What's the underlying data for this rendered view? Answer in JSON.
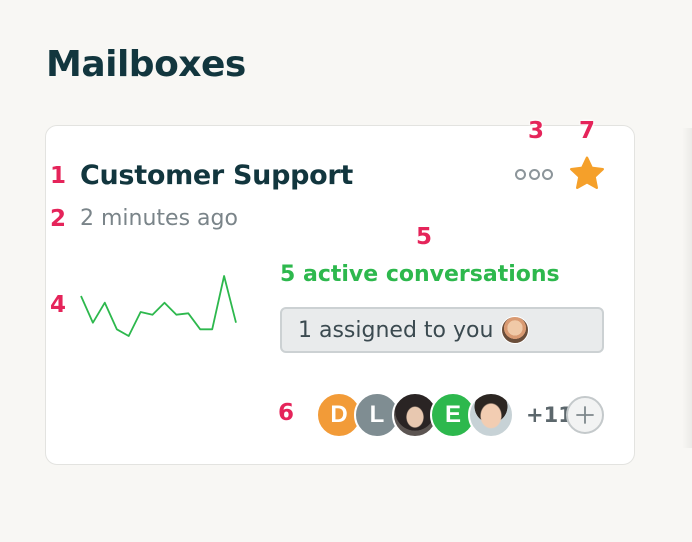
{
  "page": {
    "title": "Mailboxes"
  },
  "mailbox": {
    "name": "Customer Support",
    "updated": "2 minutes ago",
    "active_conversations": "5 active conversations",
    "assigned": "1 assigned to you",
    "starred": true,
    "activity_series": [
      6,
      4,
      5.5,
      3.5,
      3,
      4.8,
      4.6,
      5.5,
      4.6,
      4.7,
      3.5,
      3.5,
      7.5,
      4
    ],
    "team": {
      "avatars": [
        {
          "initial": "D",
          "color": "#f29b38"
        },
        {
          "initial": "L",
          "color": "#7f8d92"
        },
        {
          "initial": "",
          "color": "#4a4442"
        },
        {
          "initial": "E",
          "color": "#2db84d"
        },
        {
          "initial": "",
          "color": "#c7d2d6"
        }
      ],
      "more": "+11"
    }
  },
  "annotations": [
    "1",
    "2",
    "3",
    "4",
    "5",
    "6",
    "7"
  ],
  "colors": {
    "accent_green": "#2db84d",
    "star": "#f5a02a",
    "title": "#12363e",
    "annotation": "#e5245a"
  }
}
